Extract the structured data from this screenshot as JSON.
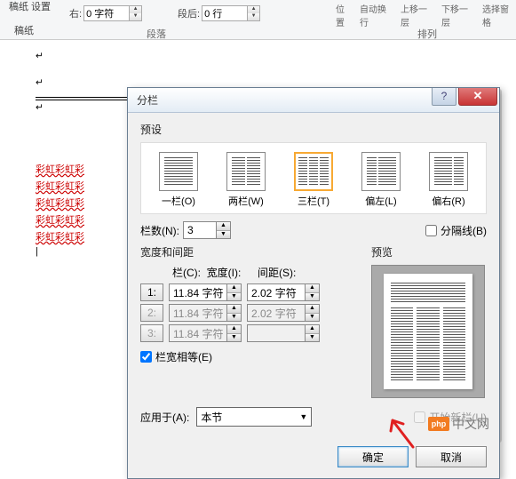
{
  "ribbon": {
    "gaozhi": "稿纸\n设置",
    "gaozhi2": "稿纸",
    "right_label": "右:",
    "right_val": "0 字符",
    "duanhou_label": "段后:",
    "duanhou_val": "0 行",
    "duanluo": "段落",
    "top_items": [
      "位置",
      "自动换行",
      "上移一层",
      "下移一层",
      "选择窗格"
    ],
    "pailie": "排列"
  },
  "doc": {
    "red_lines": [
      "彩虹彩虹彩",
      "彩虹彩虹彩",
      "彩虹彩虹彩",
      "彩虹彩虹彩",
      "彩虹彩虹彩"
    ]
  },
  "dialog": {
    "title": "分栏",
    "presets_label": "预设",
    "preset1": "一栏(O)",
    "preset2": "两栏(W)",
    "preset3": "三栏(T)",
    "preset4": "偏左(L)",
    "preset5": "偏右(R)",
    "cols_label": "栏数(N):",
    "cols_val": "3",
    "sep_line": "分隔线(B)",
    "width_label": "宽度和间距",
    "preview_label": "预览",
    "col_c": "栏(C):",
    "width_i": "宽度(I):",
    "spacing_s": "间距(S):",
    "r1": "1:",
    "w1": "11.84 字符",
    "s1": "2.02 字符",
    "r2": "2:",
    "w2": "11.84 字符",
    "s2": "2.02 字符",
    "r3": "3:",
    "w3": "11.84 字符",
    "equal_width": "栏宽相等(E)",
    "apply_label": "应用于(A):",
    "apply_val": "本节",
    "new_col": "开始新栏(U)",
    "ok": "确定",
    "cancel": "取消"
  },
  "watermark": "中文网"
}
